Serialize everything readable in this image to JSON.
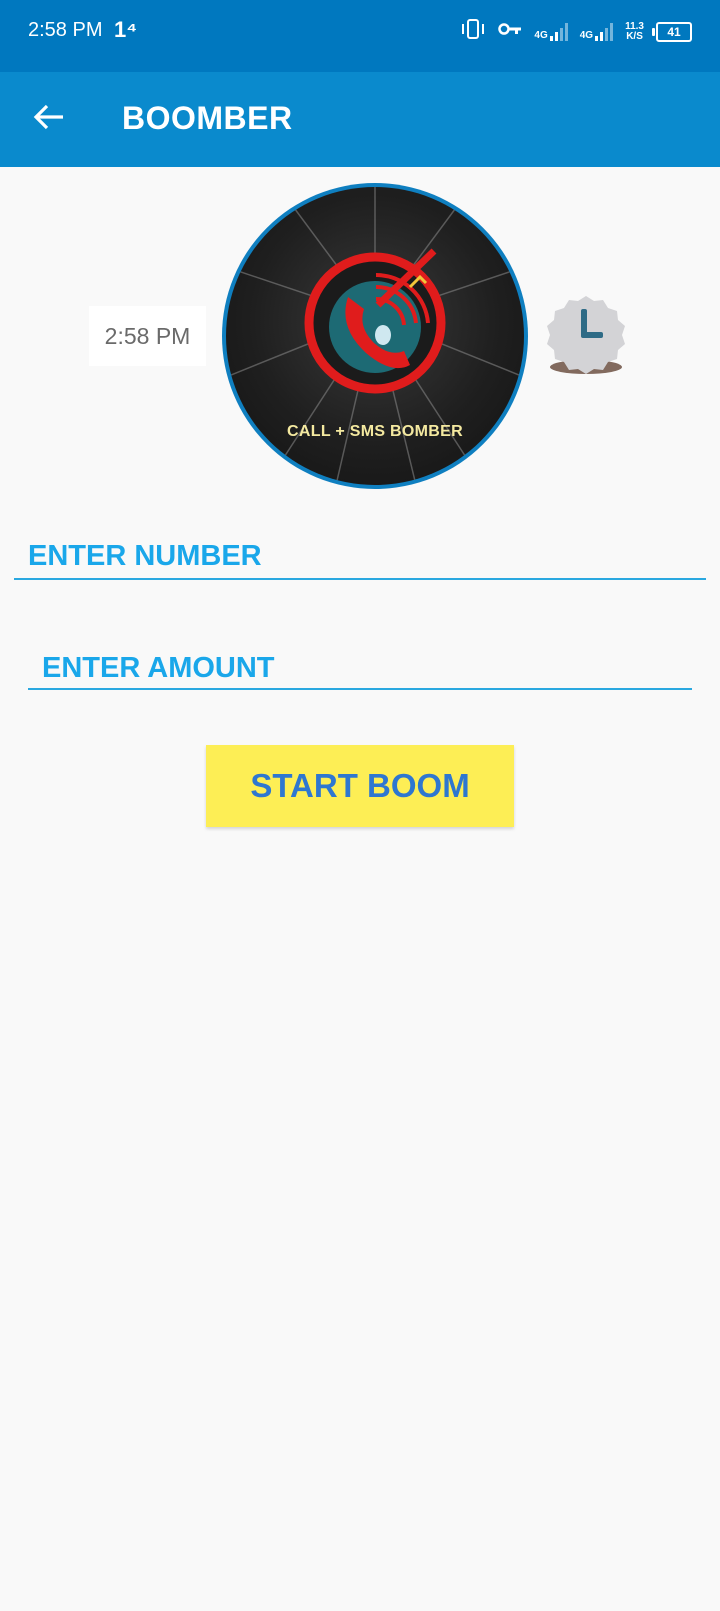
{
  "status_bar": {
    "time": "2:58 PM",
    "extra": "1⁴",
    "network1": "4G",
    "network2": "4G",
    "speed_value": "11.3",
    "speed_unit": "K/S",
    "battery": "41"
  },
  "app_bar": {
    "title": "BOOMBER",
    "back_icon": "arrow-left-icon"
  },
  "timestamp_chip": "2:58 PM",
  "logo": {
    "caption": "CALL + SMS BOMBER",
    "accent_color": "#e01c1c"
  },
  "form": {
    "number_placeholder": "ENTER NUMBER",
    "amount_placeholder": "ENTER AMOUNT",
    "submit_label": "START BOOM"
  },
  "colors": {
    "status_bar": "#0078bf",
    "app_bar": "#0a8acd",
    "field_text": "#1aa7ea",
    "button_bg": "#fdee55",
    "button_text": "#2e77d0"
  }
}
